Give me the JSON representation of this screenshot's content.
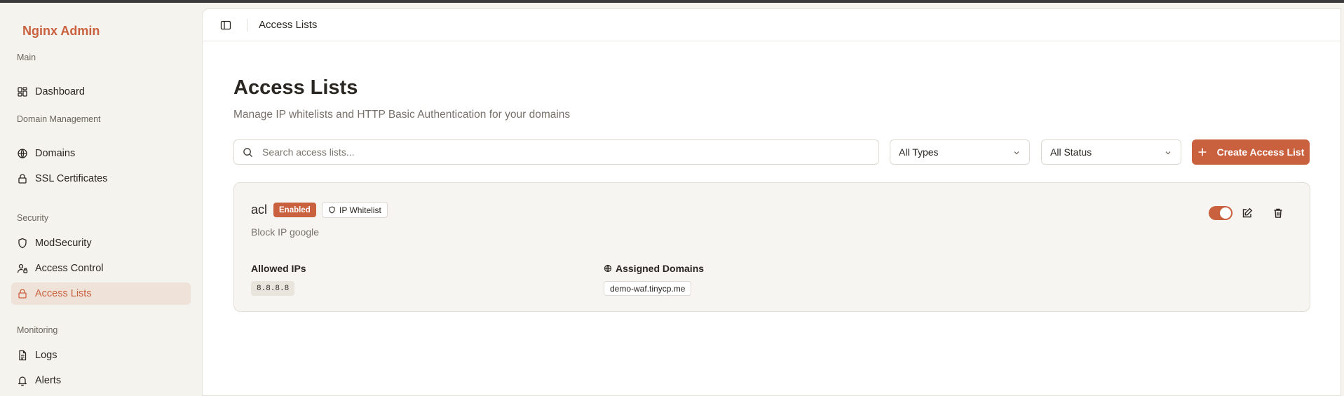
{
  "app": {
    "brand": "Nginx Admin"
  },
  "colors": {
    "accent": "#c9603e",
    "active_bg": "#efe2d8"
  },
  "sidebar": {
    "groups": [
      {
        "title": "Main",
        "items": [
          {
            "label": "Dashboard",
            "icon": "dashboard-icon"
          }
        ]
      },
      {
        "title": "Domain Management",
        "items": [
          {
            "label": "Domains",
            "icon": "globe-icon"
          },
          {
            "label": "SSL Certificates",
            "icon": "lock-icon"
          }
        ]
      },
      {
        "title": "Security",
        "items": [
          {
            "label": "ModSecurity",
            "icon": "shield-icon"
          },
          {
            "label": "Access Control",
            "icon": "user-lock-icon"
          },
          {
            "label": "Access Lists",
            "icon": "lock-icon",
            "active": true
          }
        ]
      },
      {
        "title": "Monitoring",
        "items": [
          {
            "label": "Logs",
            "icon": "file-text-icon"
          },
          {
            "label": "Alerts",
            "icon": "bell-icon"
          }
        ]
      }
    ]
  },
  "header": {
    "title": "Access Lists"
  },
  "page": {
    "title": "Access Lists",
    "subtitle": "Manage IP whitelists and HTTP Basic Authentication for your domains"
  },
  "filters": {
    "search_placeholder": "Search access lists...",
    "type_select": "All Types",
    "status_select": "All Status",
    "create_label": "Create Access List"
  },
  "access_lists": [
    {
      "name": "acl",
      "status": "Enabled",
      "type": "IP Whitelist",
      "description": "Block IP google",
      "enabled": true,
      "allowed_ips_label": "Allowed IPs",
      "allowed_ips": [
        "8.8.8.8"
      ],
      "domains_label": "Assigned Domains",
      "domains": [
        "demo-waf.tinycp.me"
      ]
    }
  ]
}
